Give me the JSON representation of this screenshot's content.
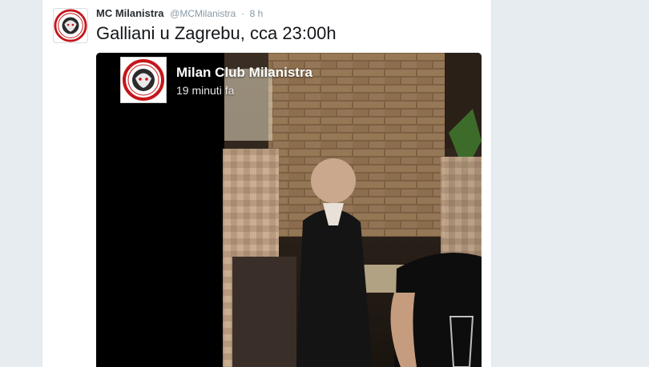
{
  "tweet": {
    "author_name": "MC Milanistra",
    "author_handle": "@MCMilanistra",
    "separator": "·",
    "timestamp": "8 h",
    "text": "Galliani u Zagrebu, cca 23:00h",
    "avatar_icon": "club-logo-icon"
  },
  "embedded_post": {
    "page_name": "Milan Club Milanistra",
    "time_ago": "19 minuti fa",
    "avatar_icon": "club-logo-icon"
  },
  "colors": {
    "background": "#e6ecf0",
    "card": "#ffffff",
    "name": "#292f33",
    "secondary_text": "#8899a6",
    "logo_red": "#c4161c"
  }
}
